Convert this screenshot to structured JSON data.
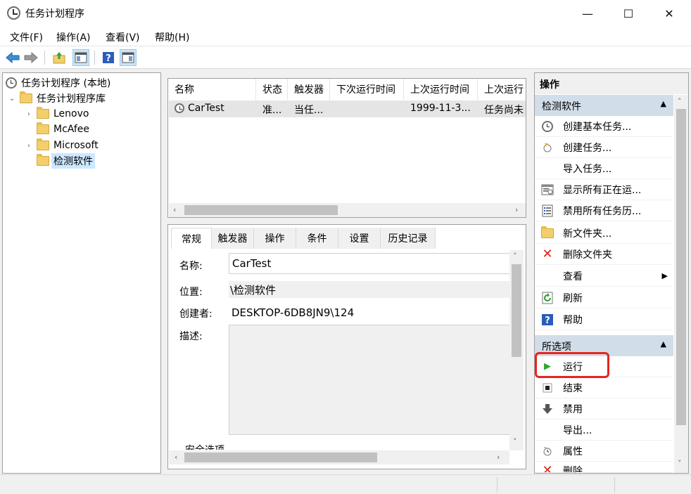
{
  "window": {
    "title": "任务计划程序",
    "controls": {
      "minimize": "—",
      "maximize": "☐",
      "close": "✕"
    }
  },
  "menu": [
    "文件(F)",
    "操作(A)",
    "查看(V)",
    "帮助(H)"
  ],
  "toolbar": {
    "icons": [
      "back-arrow-icon",
      "forward-arrow-icon",
      "folder-up-icon",
      "show-hide-console-tree-icon",
      "help-icon",
      "show-hide-action-pane-icon"
    ]
  },
  "tree": {
    "root": "任务计划程序 (本地)",
    "library": "任务计划程序库",
    "folders": [
      "Lenovo",
      "McAfee",
      "Microsoft",
      "检测软件"
    ],
    "selected": "检测软件"
  },
  "task_list": {
    "columns": [
      "名称",
      "状态",
      "触发器",
      "下次运行时间",
      "上次运行时间",
      "上次运行"
    ],
    "rows": [
      {
        "name": "CarTest",
        "status": "准...",
        "trigger": "当任...",
        "next_run": "",
        "last_run": "1999-11-3...",
        "last_result": "任务尚未"
      }
    ]
  },
  "details": {
    "tabs": [
      "常规",
      "触发器",
      "操作",
      "条件",
      "设置",
      "历史记录"
    ],
    "active_tab": "常规",
    "name_label": "名称:",
    "name_value": "CarTest",
    "location_label": "位置:",
    "location_value": "\\检测软件",
    "author_label": "创建者:",
    "author_value": "DESKTOP-6DB8JN9\\124",
    "description_label": "描述:",
    "description_value": "",
    "security_label": "安全选项"
  },
  "actions": {
    "title": "操作",
    "section1": {
      "header": "检测软件",
      "items": [
        "创建基本任务...",
        "创建任务...",
        "导入任务...",
        "显示所有正在运...",
        "禁用所有任务历...",
        "新文件夹...",
        "删除文件夹",
        "查看",
        "刷新",
        "帮助"
      ]
    },
    "section2": {
      "header": "所选项",
      "items": [
        "运行",
        "结束",
        "禁用",
        "导出...",
        "属性",
        "删除"
      ]
    }
  },
  "colors": {
    "section_header": "#d1dde9",
    "selection": "#e5e5e5",
    "highlight_box": "#e8231f",
    "folder": "#f3cf6b"
  }
}
